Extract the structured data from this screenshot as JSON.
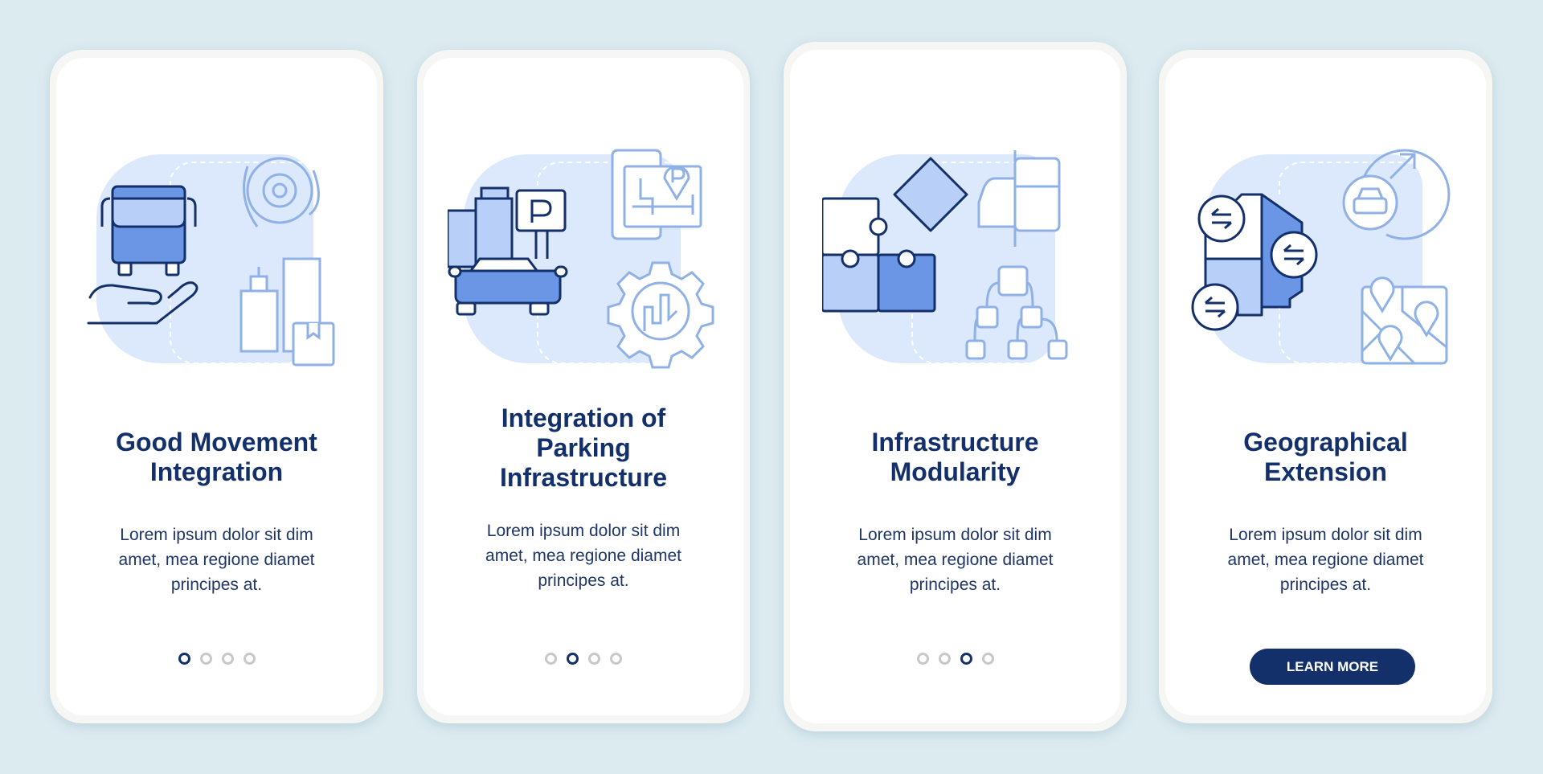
{
  "colors": {
    "background": "#dcebf0",
    "card": "#ffffff",
    "title": "#13306b",
    "body_text": "#1f3566",
    "accent_dark": "#13306b",
    "illustration_fill": "#dce8fb",
    "illustration_stroke_light": "#8fb1e6",
    "illustration_mid": "#6b96e6",
    "illustration_light": "#b8cff7",
    "dot_inactive": "#c8c8c8"
  },
  "cards": [
    {
      "title_lines": [
        "Good Movement",
        "Integration"
      ],
      "body_lines": [
        "Lorem ipsum dolor sit dim",
        "amet, mea regione diamet",
        "principes at."
      ],
      "icons": [
        "bus-icon",
        "hand-icon",
        "gear-cycle-icon",
        "city-buildings-icon",
        "package-box-icon"
      ],
      "pagination": {
        "total": 4,
        "active": 1
      }
    },
    {
      "title_lines": [
        "Integration of",
        "Parking",
        "Infrastructure"
      ],
      "body_lines": [
        "Lorem ipsum dolor sit dim",
        "amet, mea regione diamet",
        "principes at."
      ],
      "icons": [
        "car-icon",
        "buildings-icon",
        "parking-sign-icon",
        "parking-map-pin-icon",
        "gear-chart-icon"
      ],
      "pagination": {
        "total": 4,
        "active": 2
      }
    },
    {
      "title_lines": [
        "Infrastructure",
        "Modularity"
      ],
      "body_lines": [
        "Lorem ipsum dolor sit dim",
        "amet, mea regione diamet",
        "principes at."
      ],
      "icons": [
        "puzzle-icon",
        "car-bus-icon",
        "hierarchy-icon"
      ],
      "pagination": {
        "total": 4,
        "active": 3
      }
    },
    {
      "title_lines": [
        "Geographical",
        "Extension"
      ],
      "body_lines": [
        "Lorem ipsum dolor sit dim",
        "amet, mea regione diamet",
        "principes at."
      ],
      "icons": [
        "region-map-exchange-icon",
        "car-expansion-icon",
        "map-pins-icon"
      ],
      "button_label": "LEARN MORE"
    }
  ]
}
